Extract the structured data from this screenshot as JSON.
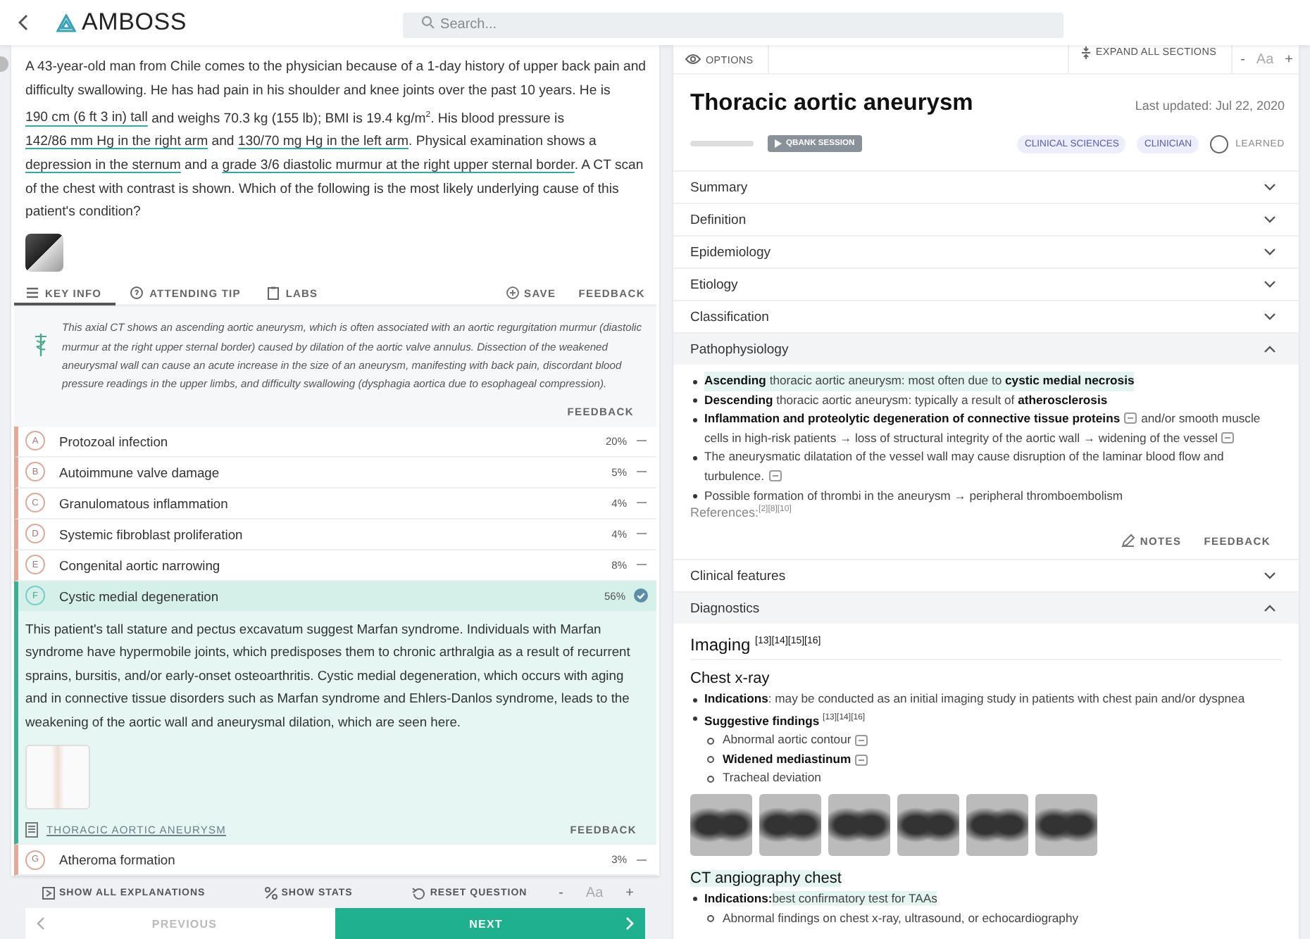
{
  "header": {
    "logo": "AMBOSS",
    "search": {
      "placeholder": "Search..."
    }
  },
  "question": {
    "stem": [
      {
        "kind": "plain",
        "text": "A 43-year-old man from Chile comes to the physician because of a 1-day history of upper back pain and difficulty swallowing. He has had pain in his shoulder and knee joints over the past 10 years. He is "
      },
      {
        "kind": "link",
        "text": "190 cm (6 ft 3 in) tall"
      },
      {
        "kind": "plain",
        "text": " and weighs 70.3 kg (155 lb); BMI is 19.4 kg/m$^{2}$. His blood pressure is "
      },
      {
        "kind": "link",
        "text": "142/86 mm Hg in the right arm"
      },
      {
        "kind": "plain",
        "text": " and "
      },
      {
        "kind": "link",
        "text": "130/70 mg Hg in the left arm"
      },
      {
        "kind": "plain",
        "text": ". Physical examination shows a "
      },
      {
        "kind": "link",
        "text": "depression in the sternum"
      },
      {
        "kind": "plain",
        "text": " and a "
      },
      {
        "kind": "link",
        "text": "grade 3/6 diastolic murmur at the right upper sternal border"
      },
      {
        "kind": "plain",
        "text": ". A CT scan of the chest with contrast is shown. Which of the following is the most likely underlying cause of this patient's condition?"
      }
    ],
    "tabs": [
      {
        "label": "KEY INFO",
        "kind": "list",
        "selected": true
      },
      {
        "label": "ATTENDING TIP",
        "kind": "tip",
        "selected": false
      },
      {
        "label": "LABS",
        "kind": "labs",
        "selected": false
      }
    ],
    "actions": {
      "save": "SAVE",
      "feedback": "FEEDBACK"
    },
    "key_info": "This axial CT shows an ascending aortic aneurysm, which is often associated with an aortic regurgitation murmur (diastolic murmur at the right upper sternal border) caused by dilation of the aortic valve annulus. Dissection of the weakened aneurysmal wall can cause an acute increase in the size of an aneurysm, manifesting with back pain, discordant blood pressure readings in the upper limbs, and difficulty swallowing (dysphagia aortica due to esophageal compression).",
    "key_info_feedback": "FEEDBACK",
    "answers": [
      {
        "letter": "A",
        "text": "Protozoal infection",
        "percent": "20%",
        "kind": "incorrect",
        "selected": false,
        "expanded": false
      },
      {
        "letter": "B",
        "text": "Autoimmune valve damage",
        "percent": "5%",
        "kind": "incorrect",
        "selected": false,
        "expanded": false
      },
      {
        "letter": "C",
        "text": "Granulomatous inflammation",
        "percent": "4%",
        "kind": "incorrect",
        "selected": false,
        "expanded": false
      },
      {
        "letter": "D",
        "text": "Systemic fibroblast proliferation",
        "percent": "4%",
        "kind": "incorrect",
        "selected": false,
        "expanded": false
      },
      {
        "letter": "E",
        "text": "Congenital aortic narrowing",
        "percent": "8%",
        "kind": "incorrect",
        "selected": false,
        "expanded": false
      },
      {
        "letter": "F",
        "text": "Cystic medial degeneration",
        "percent": "56%",
        "kind": "correct",
        "selected": true,
        "expanded": true,
        "explanation": "This patient's tall stature and pectus excavatum suggest Marfan syndrome. Individuals with Marfan syndrome have hypermobile joints, which predisposes them to chronic arthralgia as a result of recurrent sprains, bursitis, and/or early-onset osteoarthritis. Cystic medial degeneration, which occurs with aging and in connective tissue disorders such as Marfan syndrome and Ehlers-Danlos syndrome, leads to the weakening of the aortic wall and aneurysmal dilation, which are seen here.",
        "article_link": "THORACIC AORTIC ANEURYSM",
        "feedback": "FEEDBACK"
      },
      {
        "letter": "G",
        "text": "Atheroma formation",
        "percent": "3%",
        "kind": "incorrect",
        "selected": false,
        "expanded": false
      }
    ],
    "toolbar": {
      "show_all": "SHOW ALL EXPLANATIONS",
      "show_stats": "SHOW STATS",
      "reset": "RESET QUESTION",
      "minus": "-",
      "font": "Aa",
      "plus": "+"
    },
    "nav": {
      "previous": {
        "label": "PREVIOUS",
        "disabled": true
      },
      "next": {
        "label": "NEXT",
        "disabled": false
      }
    }
  },
  "article": {
    "toolbar": {
      "options": "OPTIONS",
      "expand_all": "EXPAND ALL SECTIONS",
      "minus": "-",
      "font": "Aa",
      "plus": "+"
    },
    "title": "Thoracic aortic aneurysm",
    "progress": {
      "level": 0
    },
    "last_updated": "Last updated: Jul 22, 2020",
    "qbank": "QBANK SESSION",
    "tags": [
      "CLINICAL SCIENCES",
      "CLINICIAN"
    ],
    "learned": {
      "label": "LEARNED",
      "checked": false
    },
    "sections": [
      {
        "title": "Summary",
        "expanded": false
      },
      {
        "title": "Definition",
        "expanded": false
      },
      {
        "title": "Epidemiology",
        "expanded": false
      },
      {
        "title": "Etiology",
        "expanded": false
      },
      {
        "title": "Classification",
        "expanded": false
      },
      {
        "title": "Pathophysiology",
        "expanded": true,
        "kind": "bullets",
        "bullets": [
          {
            "highlighted": true,
            "parts": [
              {
                "kind": "text",
                "text": "**Ascending** thoracic aortic aneurysm: most often due to **cystic medial necrosis**"
              }
            ]
          },
          {
            "highlighted": false,
            "parts": [
              {
                "kind": "text",
                "text": "**Descending** thoracic aortic aneurysm: typically a result of **atherosclerosis**"
              }
            ]
          },
          {
            "highlighted": false,
            "parts": [
              {
                "kind": "text",
                "text": "**Inflammation and proteolytic degeneration of connective tissue proteins**"
              },
              {
                "kind": "note"
              },
              {
                "kind": "text",
                "text": "and/or smooth muscle cells in high-risk patients → loss of structural integrity of the aortic wall → widening of the vessel"
              },
              {
                "kind": "note"
              }
            ]
          },
          {
            "highlighted": false,
            "parts": [
              {
                "kind": "text",
                "text": "The aneurysmatic dilatation of the vessel wall may cause disruption of the laminar blood flow and turbulence."
              },
              {
                "kind": "note"
              }
            ]
          },
          {
            "highlighted": false,
            "parts": [
              {
                "kind": "text",
                "text": "Possible formation of thrombi in the aneurysm → peripheral thromboembolism"
              }
            ]
          }
        ],
        "references": "References:$^{[2][8][10]}$",
        "notes": "NOTES",
        "feedback": "FEEDBACK"
      },
      {
        "title": "Clinical features",
        "expanded": false
      },
      {
        "title": "Diagnostics",
        "expanded": true,
        "kind": "imaging",
        "heading": "Imaging $^{[13][14][15][16]}$",
        "subsections": [
          {
            "heading": "Chest x-ray",
            "highlighted": false,
            "bullets": [
              {
                "label": "Indications",
                "text": ": may be conducted as an initial imaging study in patients with chest pain and/or dyspnea",
                "highlighted": false
              },
              {
                "label": "Suggestive findings",
                "text": " $^{[13][14][16]}$",
                "highlighted": false,
                "children": [
                  {
                    "text": "Abnormal aortic contour",
                    "bold": false,
                    "note": true
                  },
                  {
                    "text": "Widened mediastinum",
                    "bold": true,
                    "note": true
                  },
                  {
                    "text": "Tracheal deviation",
                    "bold": false,
                    "note": false
                  }
                ]
              }
            ],
            "images": [
              {
                "kind": "xray"
              },
              {
                "kind": "xray"
              },
              {
                "kind": "xray"
              },
              {
                "kind": "xray"
              },
              {
                "kind": "xray"
              },
              {
                "kind": "xray"
              }
            ]
          },
          {
            "heading": "CT angiography chest",
            "highlighted": true,
            "bullets": [
              {
                "label": "Indications:",
                "text": "best confirmatory test for TAAs",
                "highlighted": true,
                "children": [
                  {
                    "text": "Abnormal findings on chest x-ray, ultrasound, or echocardiography",
                    "bold": false,
                    "note": false
                  }
                ]
              }
            ]
          }
        ]
      }
    ]
  }
}
